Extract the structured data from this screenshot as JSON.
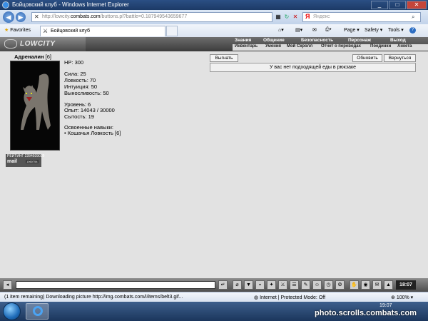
{
  "window": {
    "title": "Бойцовский клуб - Windows Internet Explorer",
    "min": "_",
    "max": "□",
    "close": "✕"
  },
  "address": {
    "url_prefix": "http://lowcity.",
    "url_domain": "combats.com",
    "url_rest": "/buttons.pl?battle=0.187949543659677",
    "search_placeholder": "Яндекс",
    "search_logo": "Я"
  },
  "favorites": {
    "label": "Favorites",
    "tab_title": "Бойцовский клуб"
  },
  "ie_toolbar": {
    "page": "Page ▾",
    "safety": "Safety ▾",
    "tools": "Tools ▾",
    "help": "?"
  },
  "game": {
    "logo": "LOWCITY",
    "menu": [
      "Знания",
      "Общение",
      "Безопасность",
      "Персонаж",
      "Выход"
    ],
    "submenu": [
      "Инвентарь",
      "Умения",
      "Мой Скролл",
      "Отчет о переводах",
      "Поединки",
      "Анкета"
    ]
  },
  "character": {
    "name": "Адреналин",
    "level_tag": "[6]",
    "hp": "HP: 300",
    "strength": "Сила: 25",
    "agility": "Ловкость: 70",
    "intuition": "Интуиция: 50",
    "endurance": "Выносливость: 50",
    "level": "Уровень: 6",
    "exp": "Опыт: 14043 / 30000",
    "satiety": "Сытость: 19",
    "skills_header": "Освоенные навыки:",
    "skill1": "• Кошачья Ловкость [6]"
  },
  "counters": {
    "c1": "РЕЙТИНГ 2284939039",
    "c2": "mail",
    "c3": "1060754"
  },
  "buttons": {
    "kick": "Выгнать",
    "refresh": "Обновить",
    "back": "Вернуться"
  },
  "message": "У вас нет подходящей еды в рюкзаке",
  "chat": {
    "clock": "18:07"
  },
  "statusbar": {
    "text": "(1 item remaining) Downloading picture http://img.combats.com/i/items/belt3.gif...",
    "zone": "Internet | Protected Mode: Off",
    "zoom": "100%"
  },
  "taskbar": {
    "time": "19:07"
  },
  "watermark": "photo.scrolls.combats.com"
}
